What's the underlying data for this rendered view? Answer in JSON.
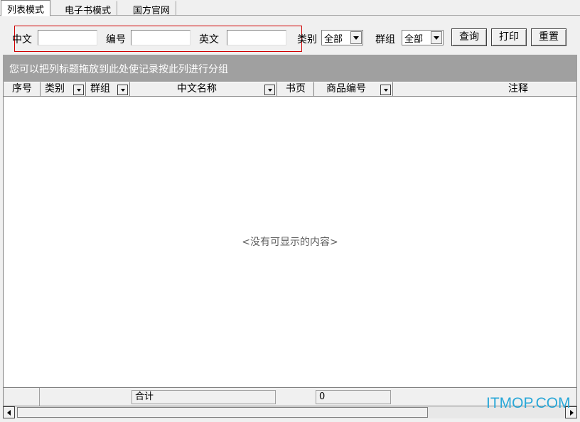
{
  "tabs": [
    "列表模式",
    "电子书模式",
    "国方官网"
  ],
  "search": {
    "chinese_label": "中文",
    "chinese_value": "",
    "number_label": "编号",
    "number_value": "",
    "english_label": "英文",
    "english_value": "",
    "category_label": "类别",
    "category_value": "全部",
    "group_label": "群组",
    "group_value": "全部",
    "query_button": "查询",
    "print_button": "打印",
    "reset_button": "重置"
  },
  "group_panel_hint": "您可以把列标题拖放到此处使记录按此列进行分组",
  "columns": [
    "序号",
    "类别",
    "群组",
    "中文名称",
    "书页",
    "商品编号",
    "注释"
  ],
  "empty_message": "<没有可显示的内容>",
  "footer": {
    "total_label": "合计",
    "total_value": "0"
  },
  "watermark": "ITMOP.COM",
  "colors": {
    "group_panel": "#a0a0a0",
    "highlight_border": "#d00000",
    "watermark": "#2aa8d8"
  }
}
